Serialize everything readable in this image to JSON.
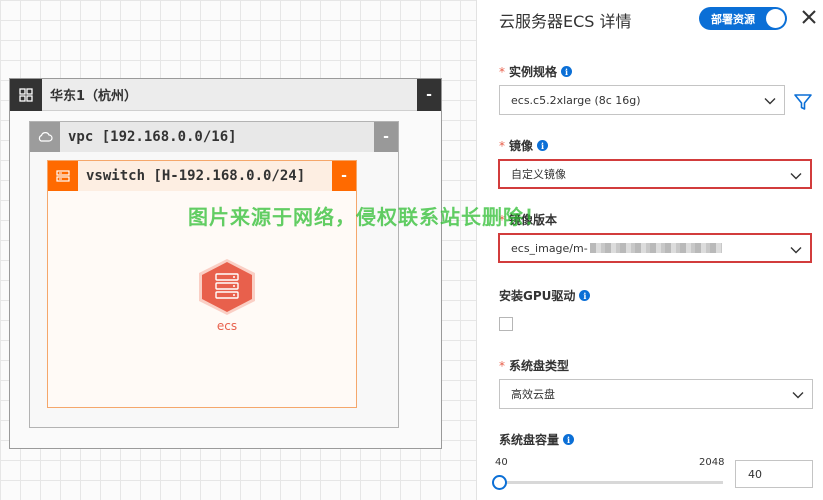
{
  "diagram": {
    "region_title": "华东1（杭州）",
    "vpc_title": "vpc [192.168.0.0/16]",
    "vswitch_title": "vswitch [H-192.168.0.0/24]",
    "collapse_label": "-",
    "ecs_label": "ecs"
  },
  "panel": {
    "title": "云服务器ECS 详情",
    "deploy_toggle_label": "部署资源",
    "fields": {
      "instance_spec": {
        "label": "实例规格",
        "value": "ecs.c5.2xlarge (8c 16g)"
      },
      "image": {
        "label": "镜像",
        "value": "自定义镜像"
      },
      "image_version": {
        "label": "镜像版本",
        "value": "ecs_image/m-"
      },
      "gpu_driver": {
        "label": "安装GPU驱动",
        "checked": false
      },
      "disk_type": {
        "label": "系统盘类型",
        "value": "高效云盘"
      },
      "disk_size": {
        "label": "系统盘容量",
        "min": "40",
        "max": "2048",
        "value": "40"
      }
    }
  },
  "watermark": "图片来源于网络，侵权联系站长删除！",
  "colors": {
    "accent": "#0b6fd6",
    "orange": "#ff6a00",
    "highlight_border": "#d23c3c",
    "ecs_node": "#e8604c",
    "watermark": "#2ebe32"
  }
}
